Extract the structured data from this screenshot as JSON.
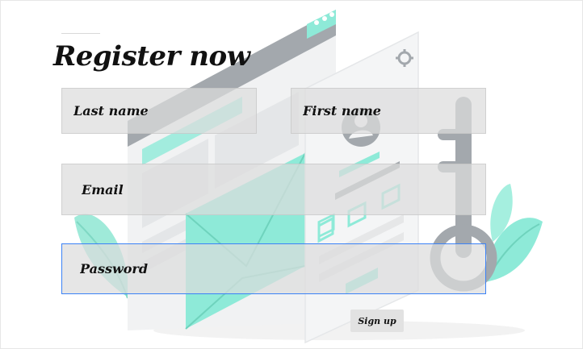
{
  "title": "Register now",
  "fields": {
    "last_name": {
      "placeholder": "Last name",
      "value": ""
    },
    "first_name": {
      "placeholder": "First name",
      "value": ""
    },
    "email": {
      "placeholder": "Email",
      "value": ""
    },
    "password": {
      "placeholder": "Password",
      "value": ""
    }
  },
  "signup_label": "Sign up",
  "colors": {
    "accent": "#8eead8",
    "illustration_gray": "#a3a8ad",
    "focus_border": "#3b82f6",
    "field_bg": "#dcdcdc"
  },
  "icons": [
    "gear-icon",
    "user-avatar-icon",
    "key-icon",
    "envelope-icon",
    "leaf-icon"
  ]
}
